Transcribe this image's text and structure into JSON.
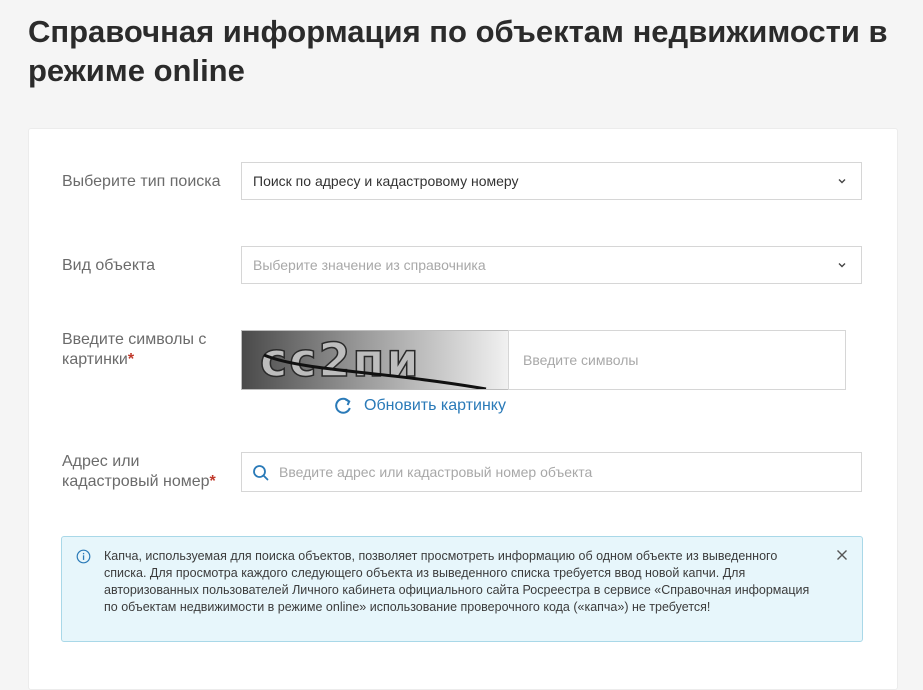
{
  "page": {
    "title": "Справочная информация по объектам недвижимости в режиме online"
  },
  "form": {
    "search_type": {
      "label": "Выберите тип поиска",
      "value": "Поиск по адресу и кадастровому номеру"
    },
    "object_type": {
      "label": "Вид объекта",
      "placeholder": "Выберите значение из справочника"
    },
    "captcha": {
      "label": "Введите символы с картинки",
      "required_mark": "*",
      "image_text": "cc2пи",
      "input_placeholder": "Введите символы",
      "refresh_label": "Обновить картинку"
    },
    "address": {
      "label": "Адрес или кадастровый номер",
      "required_mark": "*",
      "placeholder": "Введите адрес или кадастровый номер объекта"
    }
  },
  "notice": {
    "text": "Капча, используемая для поиска объектов, позволяет просмотреть информацию об одном объекте из выведенного списка. Для просмотра каждого следующего объекта из выведенного списка требуется ввод новой капчи. Для авторизованных пользователей Личного кабинета официального сайта Росреестра в сервисе «Справочная информация по объектам недвижимости в режиме online» использование проверочного кода («капча») не требуется!",
    "icon": "info-icon",
    "close_icon": "close-icon"
  },
  "colors": {
    "accent": "#2a7ab8",
    "required": "#c0392b",
    "notice_bg": "#e7f6fb",
    "notice_border": "#a9d8e8"
  }
}
